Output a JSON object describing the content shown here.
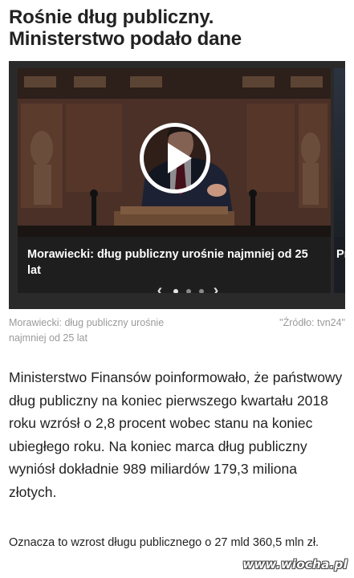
{
  "article": {
    "title_line1": "Rośnie dług publiczny.",
    "title_line2": "Ministerstwo podało dane"
  },
  "carousel": {
    "slides": [
      {
        "caption": "Morawiecki: dług publiczny urośnie najmniej od 25 lat"
      },
      {
        "caption": "Pr"
      }
    ],
    "prev_icon": "‹",
    "next_icon": "›",
    "active_index": 0,
    "dot_count": 4
  },
  "media_caption": {
    "text_line1": "Morawiecki: dług publiczny urośnie",
    "text_line2": "najmniej od 25 lat",
    "source": "\"Źródło: tvn24\""
  },
  "body": {
    "paragraph1": "Ministerstwo Finansów poinformowało, że państwowy dług publiczny na koniec pierwszego kwartału 2018 roku wzrósł o 2,8 procent wobec stanu na koniec ubiegłego roku. Na koniec marca dług publiczny wyniósł dokładnie 989 miliardów 179,3 miliona złotych.",
    "paragraph2": "Oznacza to wzrost długu publicznego o 27 mld 360,5 mln zł."
  },
  "watermark": "www.wiocha.pl"
}
